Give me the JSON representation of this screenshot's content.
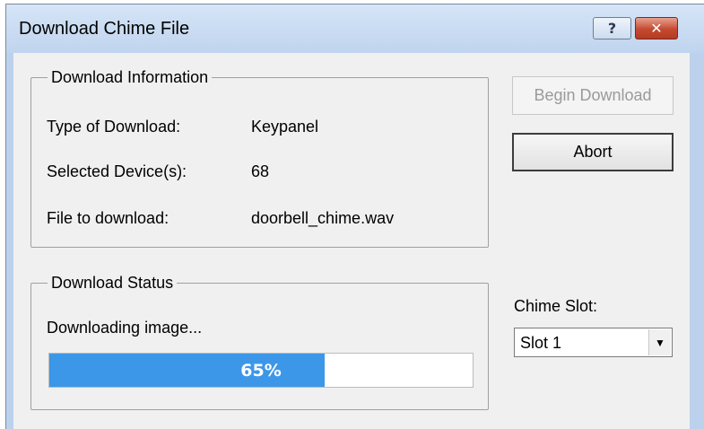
{
  "window": {
    "title": "Download Chime File",
    "help_glyph": "?",
    "close_glyph": "✕"
  },
  "download_info": {
    "legend": "Download Information",
    "type_label": "Type of Download:",
    "type_value": "Keypanel",
    "devices_label": "Selected Device(s):",
    "devices_value": "68",
    "file_label": "File to download:",
    "file_value": "doorbell_chime.wav"
  },
  "buttons": {
    "begin_label": "Begin Download",
    "begin_enabled": false,
    "abort_label": "Abort"
  },
  "download_status": {
    "legend": "Download Status",
    "message": "Downloading image...",
    "progress_percent": 65,
    "progress_text": "65%",
    "progress_color": "#3c97e8"
  },
  "chime_slot": {
    "label": "Chime Slot:",
    "selected": "Slot 1",
    "arrow_icon": "chevron-down-icon"
  }
}
